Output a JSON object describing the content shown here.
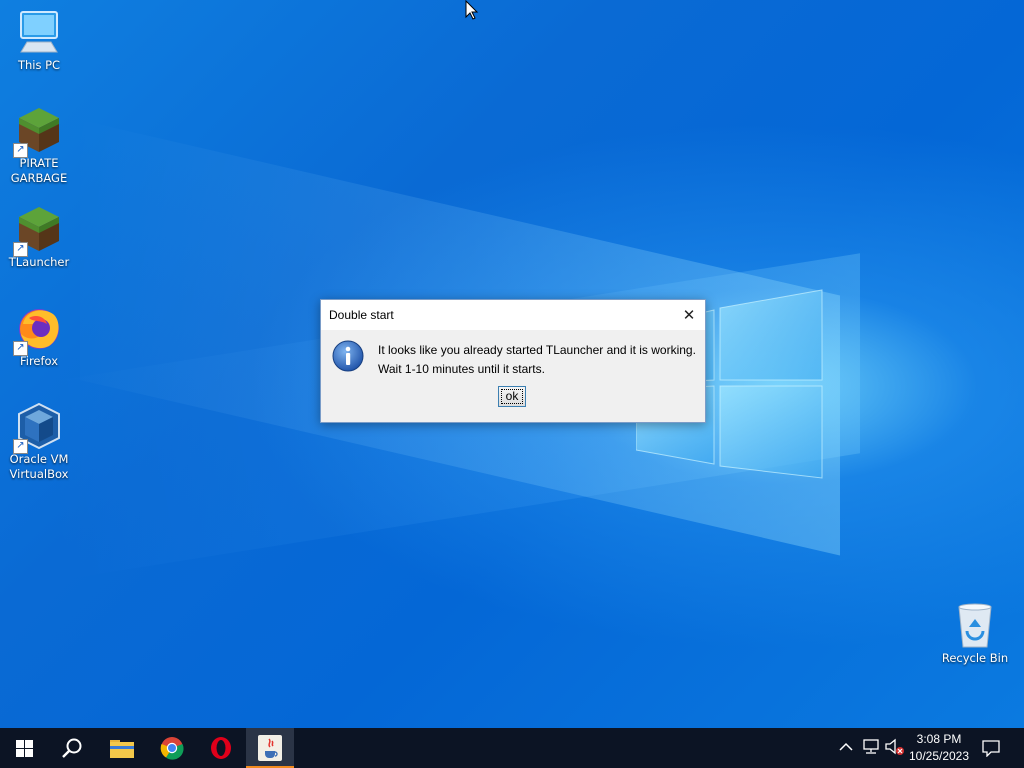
{
  "desktop": {
    "icons": [
      {
        "label": "This PC",
        "icon": "computer-icon"
      },
      {
        "label": "PIRATE\nGARBAGE",
        "icon": "minecraft-grass-icon"
      },
      {
        "label": "TLauncher",
        "icon": "minecraft-grass-icon"
      },
      {
        "label": "Firefox",
        "icon": "firefox-icon"
      },
      {
        "label": "Oracle VM\nVirtualBox",
        "icon": "virtualbox-icon"
      },
      {
        "label": "Recycle Bin",
        "icon": "recycle-bin-icon"
      }
    ]
  },
  "dialog": {
    "title": "Double start",
    "message_line1": "It looks like you already started TLauncher and it is working.",
    "message_line2": "Wait 1-10 minutes until it starts.",
    "ok_label": "ok",
    "close_glyph": "✕",
    "icon": "info-icon"
  },
  "taskbar": {
    "pinned": [
      {
        "name": "start-button",
        "icon": "windows-logo-icon"
      },
      {
        "name": "search-button",
        "icon": "search-icon"
      },
      {
        "name": "file-explorer",
        "icon": "folder-icon"
      },
      {
        "name": "chrome",
        "icon": "chrome-icon"
      },
      {
        "name": "opera",
        "icon": "opera-icon"
      },
      {
        "name": "java",
        "icon": "java-icon",
        "active": true
      }
    ],
    "clock_time": "3:08 PM",
    "clock_date": "10/25/2023"
  },
  "colors": {
    "taskbar_bg": "#0c1424",
    "active_indicator": "#f28a1e",
    "wallpaper_blue": "#0a6fd6",
    "dialog_bg": "#f0f0f0"
  }
}
